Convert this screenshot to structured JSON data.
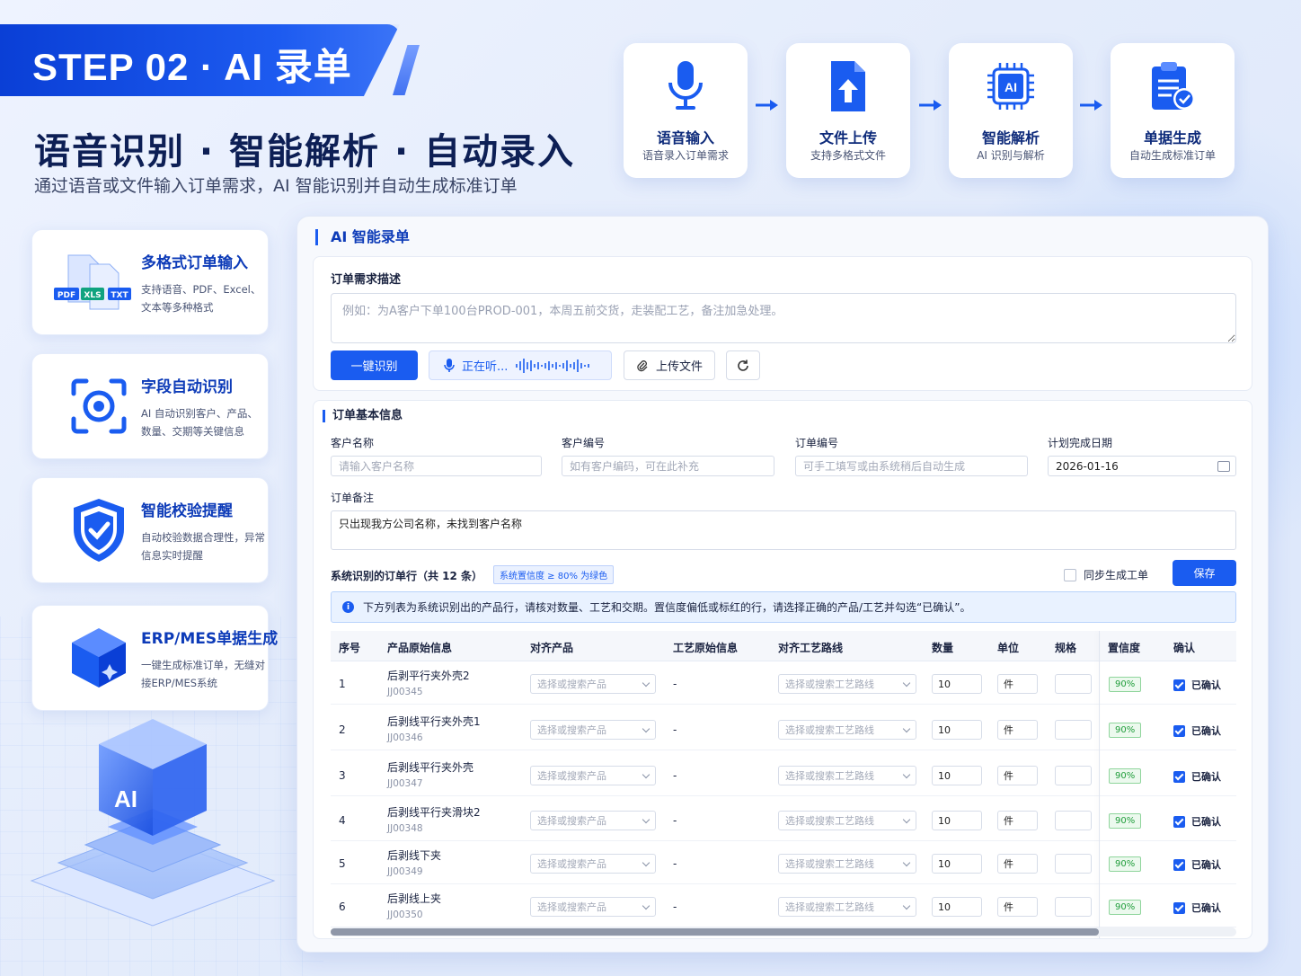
{
  "step_banner": "STEP 02 · AI 录单",
  "main_title": "语音识别 · 智能解析 · 自动录入",
  "subtitle": "通过语音或文件输入订单需求，AI 智能识别并自动生成标准订单",
  "flow": [
    {
      "title": "语音输入",
      "desc": "语音录入订单需求",
      "icon": "microphone-icon"
    },
    {
      "title": "文件上传",
      "desc": "支持多格式文件",
      "icon": "file-upload-icon"
    },
    {
      "title": "智能解析",
      "desc": "AI 识别与解析",
      "icon": "ai-chip-icon"
    },
    {
      "title": "单据生成",
      "desc": "自动生成标准订单",
      "icon": "clipboard-check-icon"
    }
  ],
  "features": [
    {
      "title": "多格式订单输入",
      "desc": "支持语音、PDF、Excel、文本等多种格式",
      "icon": "multi-file-icon",
      "badges": [
        "PDF",
        "XLS",
        "TXT"
      ]
    },
    {
      "title": "字段自动识别",
      "desc": "AI 自动识别客户、产品、数量、交期等关键信息",
      "icon": "scan-target-icon"
    },
    {
      "title": "智能校验提醒",
      "desc": "自动校验数据合理性，异常信息实时提醒",
      "icon": "shield-check-icon"
    },
    {
      "title": "ERP/MES单据生成",
      "desc": "一键生成标准订单，无缝对接ERP/MES系统",
      "icon": "cube-icon"
    }
  ],
  "ai_cube_label": "AI",
  "panel": {
    "title": "AI 智能录单",
    "demand_label": "订单需求描述",
    "demand_placeholder": "例如：为A客户下单100台PROD-001，本周五前交货，走装配工艺，备注加急处理。",
    "btn_recognize": "一键识别",
    "btn_listening": "正在听...",
    "btn_upload": "上传文件"
  },
  "basic": {
    "title": "订单基本信息",
    "customer_name_label": "客户名称",
    "customer_name_placeholder": "请输入客户名称",
    "customer_code_label": "客户编号",
    "customer_code_placeholder": "如有客户编码，可在此补充",
    "order_no_label": "订单编号",
    "order_no_placeholder": "可手工填写或由系统稍后自动生成",
    "plan_date_label": "计划完成日期",
    "plan_date_value": "2026-01-16",
    "remark_label": "订单备注",
    "remark_value": "只出现我方公司名称，未找到客户名称"
  },
  "recognized": {
    "title": "系统识别的订单行（共 12 条）",
    "tag": "系统置信度 ≥ 80% 为绿色",
    "sync_label": "同步生成工单",
    "save_label": "保存",
    "info": "下方列表为系统识别出的产品行，请核对数量、工艺和交期。置信度偏低或标红的行，请选择正确的产品/工艺并勾选“已确认”。"
  },
  "table": {
    "headers": [
      "序号",
      "产品原始信息",
      "对齐产品",
      "工艺原始信息",
      "对齐工艺路线",
      "数量",
      "单位",
      "规格",
      "置信度",
      "确认"
    ],
    "product_placeholder": "选择或搜索产品",
    "route_placeholder": "选择或搜索工艺路线",
    "rows": [
      {
        "no": "1",
        "name": "后剥平行夹外壳2",
        "code": "JJ00345",
        "craft": "-",
        "qty": "10",
        "unit": "件",
        "conf": "90%",
        "confirm": "已确认"
      },
      {
        "no": "2",
        "name": "后剥线平行夹外壳1",
        "code": "JJ00346",
        "craft": "-",
        "qty": "10",
        "unit": "件",
        "conf": "90%",
        "confirm": "已确认"
      },
      {
        "no": "3",
        "name": "后剥线平行夹外壳",
        "code": "JJ00347",
        "craft": "-",
        "qty": "10",
        "unit": "件",
        "conf": "90%",
        "confirm": "已确认"
      },
      {
        "no": "4",
        "name": "后剥线平行夹滑块2",
        "code": "JJ00348",
        "craft": "-",
        "qty": "10",
        "unit": "件",
        "conf": "90%",
        "confirm": "已确认"
      },
      {
        "no": "5",
        "name": "后剥线下夹",
        "code": "JJ00349",
        "craft": "-",
        "qty": "10",
        "unit": "件",
        "conf": "90%",
        "confirm": "已确认"
      },
      {
        "no": "6",
        "name": "后剥线上夹",
        "code": "JJ00350",
        "craft": "-",
        "qty": "10",
        "unit": "件",
        "conf": "90%",
        "confirm": "已确认"
      }
    ]
  }
}
